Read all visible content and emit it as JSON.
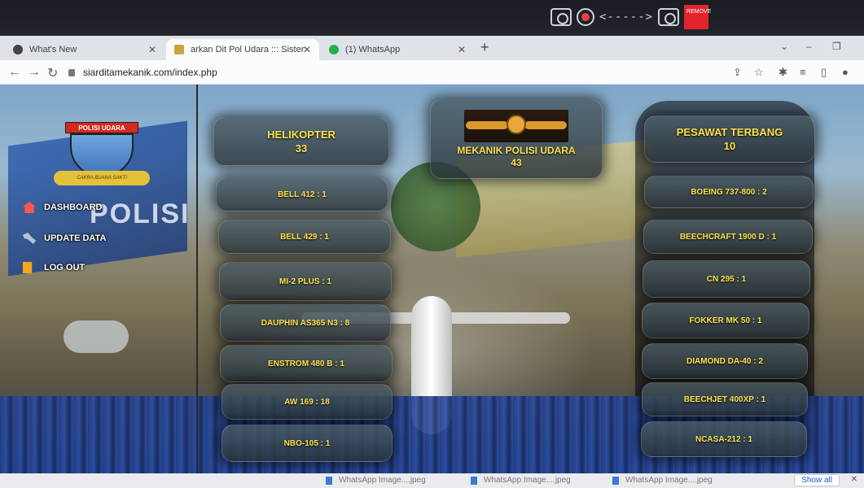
{
  "recorder": {
    "dashes": "<-----> ",
    "remove_label": "REMOVE"
  },
  "browser": {
    "tabs": [
      {
        "title": "What's New",
        "active": false
      },
      {
        "title": "arkan Dit Pol Udara ::: Sistem In",
        "active": true
      },
      {
        "title": "(1) WhatsApp",
        "active": false
      }
    ],
    "new_tab": "+",
    "url": "siarditamekanik.com/index.php"
  },
  "sidebar": {
    "logo": {
      "banner": "POLISI UDARA",
      "motto": "CAKRA BUANA SAKTI"
    },
    "menu": [
      {
        "label": "DASHBOARD",
        "icon": "home-icon"
      },
      {
        "label": "UPDATE DATA",
        "icon": "wrench-icon"
      },
      {
        "label": "LOG OUT",
        "icon": "logout-icon"
      }
    ]
  },
  "background": {
    "sign_text": "POLISI"
  },
  "summary": {
    "helikopter": {
      "label": "HELIKOPTER",
      "count": "33"
    },
    "mekanik": {
      "label": "MEKANIK POLISI UDARA",
      "count": "43"
    },
    "pesawat": {
      "label": "PESAWAT TERBANG",
      "count": "10"
    }
  },
  "helikopter_items": [
    "BELL 412 : 1",
    "BELL 429 : 1",
    "MI-2 PLUS : 1",
    "DAUPHIN AS365 N3 : 8",
    "ENSTROM 480 B : 1",
    "AW 169 : 18",
    "NBO-105 : 1"
  ],
  "pesawat_items": [
    "BOEING 737-800 : 2",
    "BEECHCRAFT 1900 D : 1",
    "CN 295 : 1",
    "FOKKER MK 50 : 1",
    "DIAMOND DA-40 : 2",
    "BEECHJET 400XP : 1",
    "NCASA-212 : 1"
  ],
  "downloads": {
    "items": [
      "WhatsApp Image....jpeg",
      "WhatsApp Image....jpeg",
      "WhatsApp Image....jpeg"
    ],
    "show_all": "Show all"
  }
}
